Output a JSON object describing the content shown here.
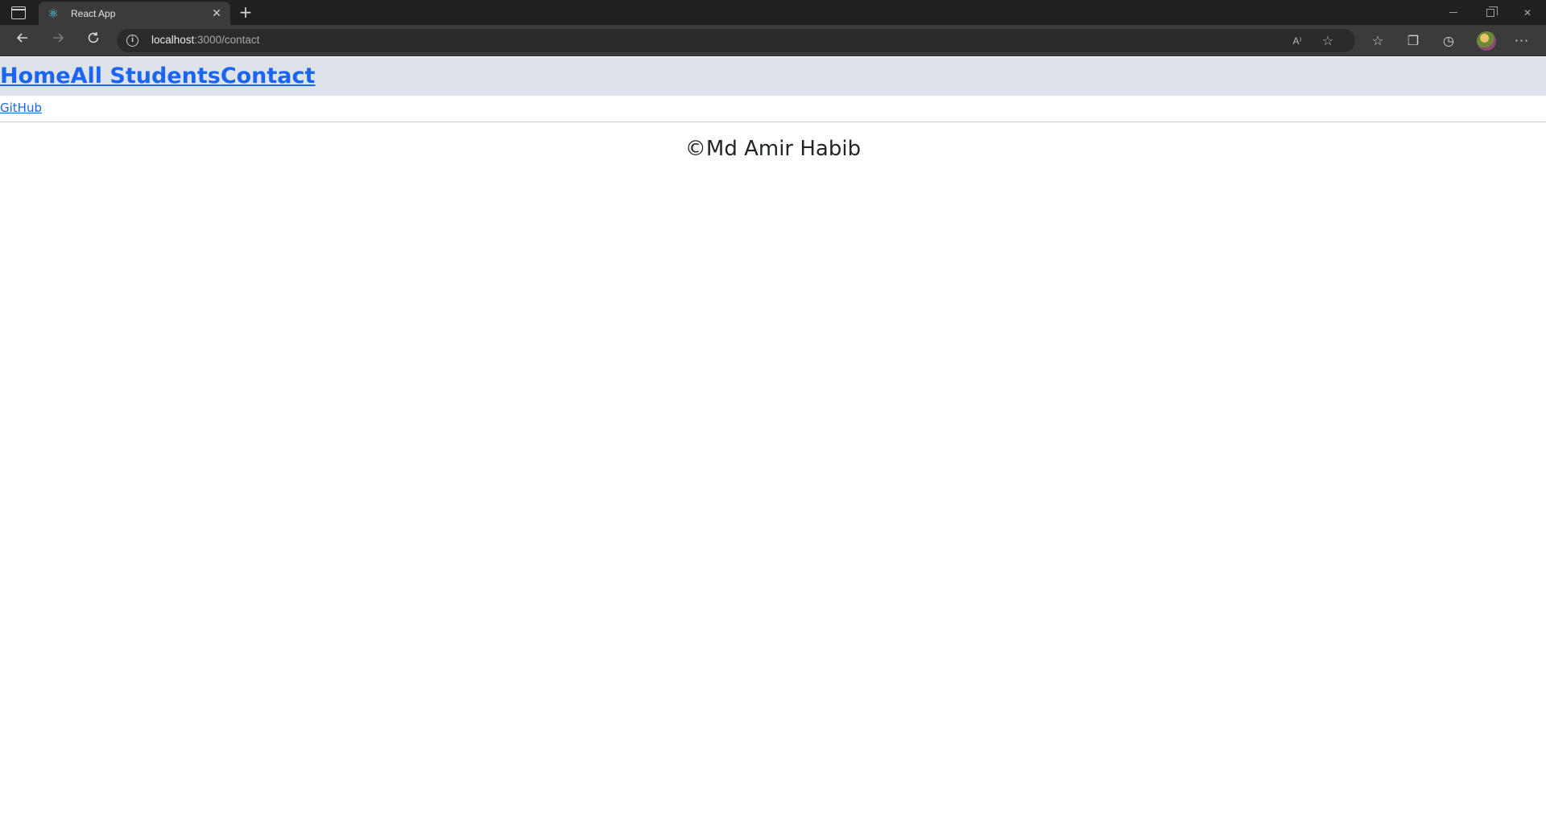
{
  "browser": {
    "tab": {
      "title": "React App",
      "favicon": "react-icon",
      "close": "✕"
    },
    "new_tab": "+",
    "url": {
      "host": "localhost",
      "rest": ":3000/contact"
    },
    "read_aloud": "A⁾",
    "icons": [
      "tab-actions-icon",
      "back-icon",
      "forward-icon",
      "reload-icon",
      "info-icon",
      "read-aloud-icon",
      "add-favorite-icon",
      "favorites-icon",
      "collections-icon",
      "history-icon",
      "profile-avatar",
      "more-icon"
    ]
  },
  "nav": {
    "links": [
      "Home",
      "All Students",
      "Contact"
    ]
  },
  "github_link": "GitHub",
  "footer": {
    "copyright": "©Md Amir Habib"
  },
  "colors": {
    "link": "#1a66f0",
    "nav_bg": "#dee2e9",
    "text": "#212529"
  }
}
